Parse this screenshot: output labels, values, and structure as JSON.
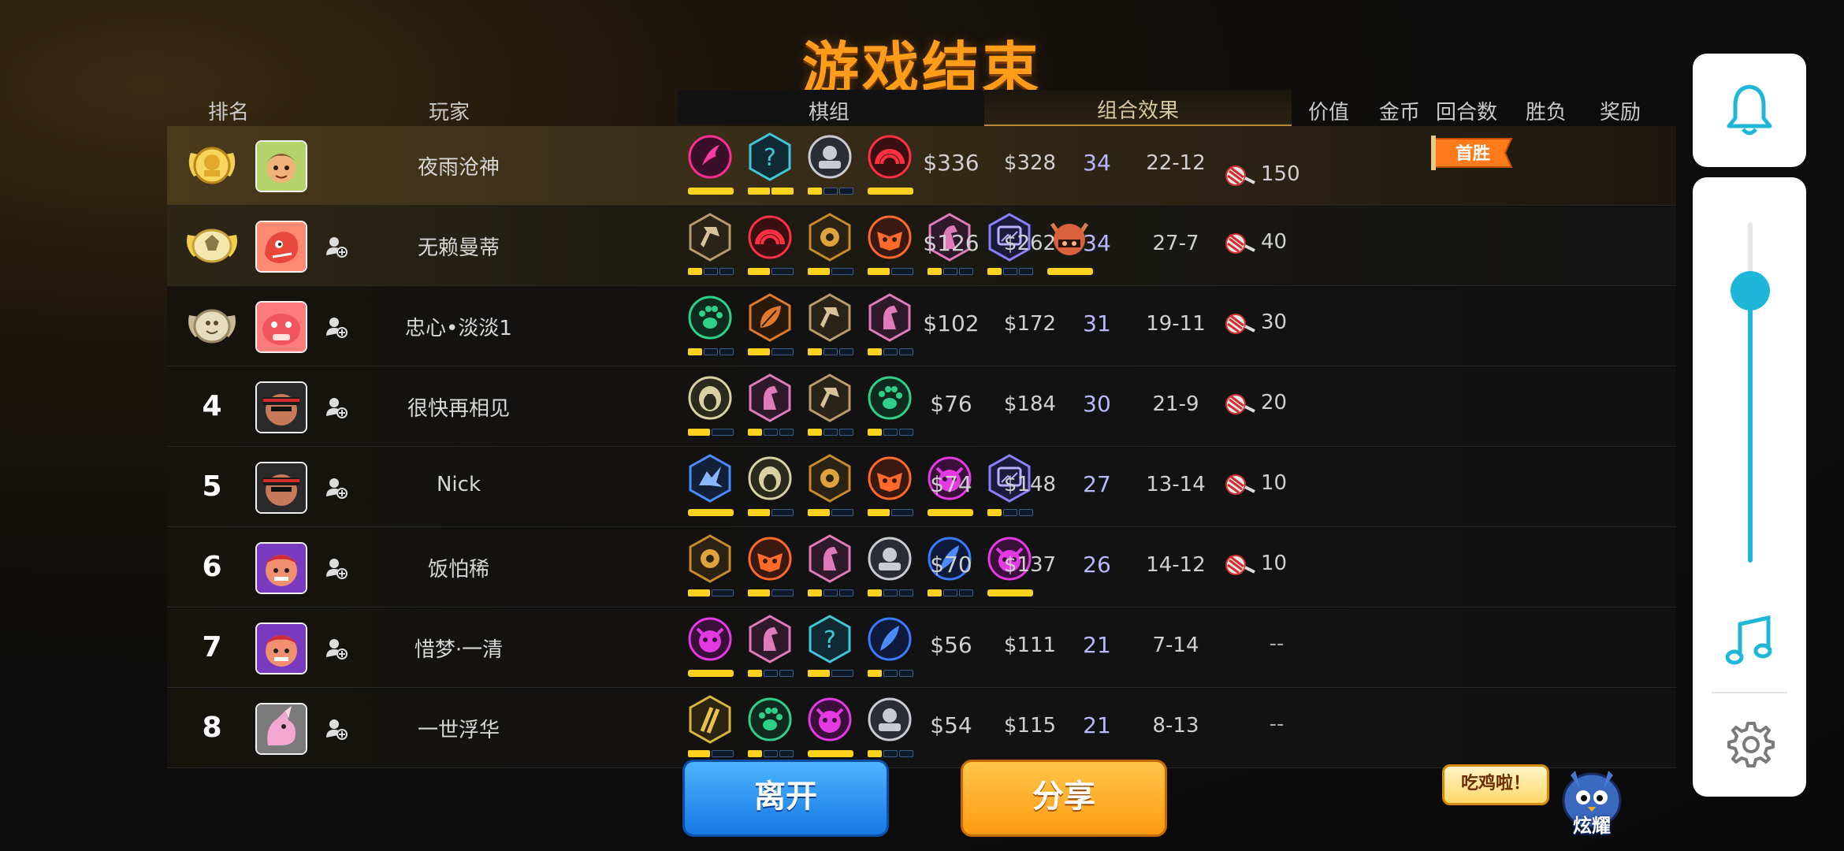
{
  "title": "游戏结束",
  "headers": {
    "rank": "排名",
    "player": "玩家",
    "sets": "棋组",
    "combo": "组合效果",
    "value": "价值",
    "gold": "金币",
    "rounds": "回合数",
    "winloss": "胜负",
    "reward": "奖励"
  },
  "first_win_tag": "首胜",
  "rows": [
    {
      "rank": "1",
      "name": "夜雨沧神",
      "value": "$336",
      "gold": "$328",
      "rounds": "34",
      "wl": "22-12",
      "reward": "150"
    },
    {
      "rank": "2",
      "name": "无赖曼蒂",
      "value": "$126",
      "gold": "$262",
      "rounds": "34",
      "wl": "27-7",
      "reward": "40"
    },
    {
      "rank": "3",
      "name": "忠心•淡淡1",
      "value": "$102",
      "gold": "$172",
      "rounds": "31",
      "wl": "19-11",
      "reward": "30"
    },
    {
      "rank": "4",
      "name": "很快再相见",
      "value": "$76",
      "gold": "$184",
      "rounds": "30",
      "wl": "21-9",
      "reward": "20"
    },
    {
      "rank": "5",
      "name": "Nick",
      "value": "$74",
      "gold": "$148",
      "rounds": "27",
      "wl": "13-14",
      "reward": "10"
    },
    {
      "rank": "6",
      "name": "饭怕稀",
      "value": "$70",
      "gold": "$137",
      "rounds": "26",
      "wl": "14-12",
      "reward": "10"
    },
    {
      "rank": "7",
      "name": "惜梦·一清",
      "value": "$56",
      "gold": "$111",
      "rounds": "21",
      "wl": "7-14",
      "reward": "--"
    },
    {
      "rank": "8",
      "name": "一世浮华",
      "value": "$54",
      "gold": "$115",
      "rounds": "21",
      "wl": "8-13",
      "reward": "--"
    }
  ],
  "buttons": {
    "leave": "离开",
    "share": "分享"
  },
  "bubble": "吃鸡啦！",
  "mascot_label": "炫耀",
  "side_panel": {
    "icons": [
      "bell-icon",
      "music-note-icon",
      "gear-icon"
    ],
    "volume_level": 0.8
  },
  "colors": {
    "accent_orange": "#ff9c1a",
    "slider_blue": "#1eb7d9",
    "button_blue": "#1579e3",
    "button_orange": "#ff9b12"
  }
}
